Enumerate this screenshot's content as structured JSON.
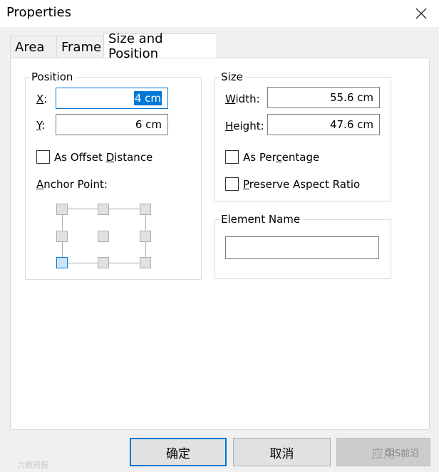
{
  "window": {
    "title": "Properties"
  },
  "tabs": [
    {
      "label": "Area"
    },
    {
      "label": "Frame"
    },
    {
      "label": "Size and Position"
    }
  ],
  "position": {
    "legend": "Position",
    "x_label": "X",
    "x_value": "4 cm",
    "y_label": "Y",
    "y_value": "6 cm",
    "offset_label": "As Offset Distance",
    "anchor_label": "Anchor Point:",
    "anchor_selected": "bottom-left"
  },
  "size": {
    "legend": "Size",
    "width_label": "Width:",
    "width_value": "55.6 cm",
    "height_label": "Height:",
    "height_value": "47.6 cm",
    "percentage_label": "As Percentage",
    "aspect_label": "Preserve Aspect Ratio"
  },
  "element_name": {
    "legend": "Element Name",
    "value": ""
  },
  "buttons": {
    "ok": "确定",
    "cancel": "取消",
    "apply": "应用"
  },
  "watermark": {
    "left": "六截预报",
    "right": "GIS前沿"
  }
}
